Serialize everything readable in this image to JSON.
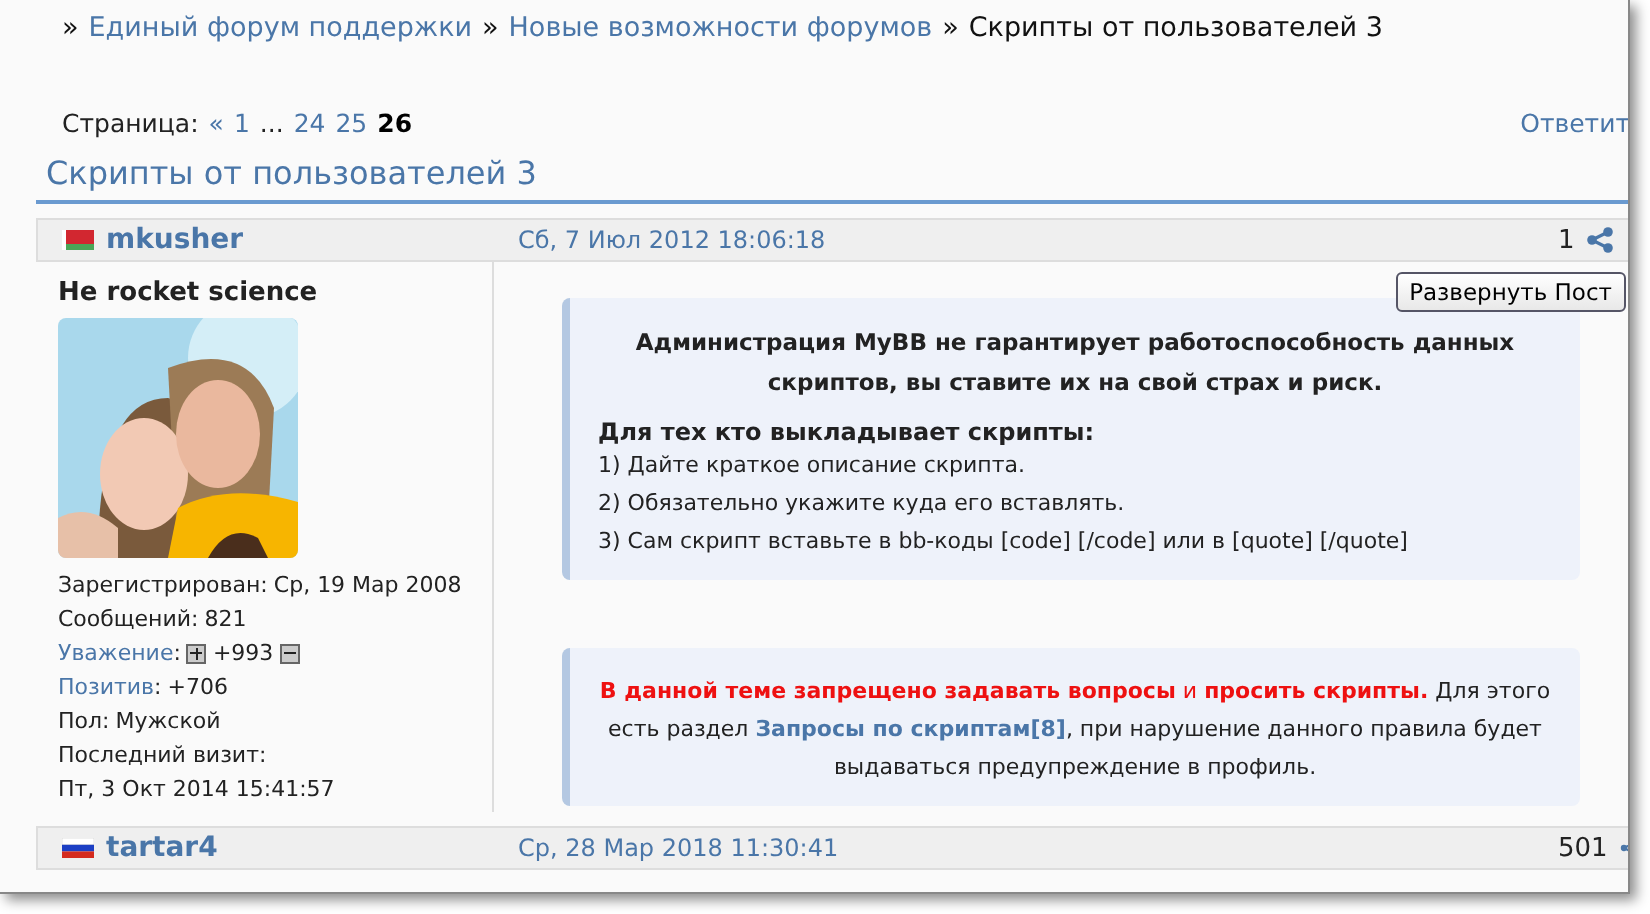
{
  "breadcrumb": [
    {
      "kind": "link",
      "text": "Единый форум поддержки"
    },
    {
      "kind": "link",
      "text": "Новые возможности форумов"
    },
    {
      "kind": "current",
      "text": "Скрипты от пользователей 3"
    }
  ],
  "breadcrumb_separator": "»",
  "pagination": {
    "label": "Страница:",
    "prev": "«",
    "pages": [
      {
        "text": "1",
        "selected": false
      },
      {
        "text": "...",
        "kind": "gap",
        "selected": false
      },
      {
        "text": "24",
        "selected": false
      },
      {
        "text": "25",
        "selected": false
      },
      {
        "text": "26",
        "selected": true
      }
    ]
  },
  "reply_link": "Ответит",
  "topic_title": "Скрипты от пользователей 3",
  "posts": [
    {
      "author": "mkusher",
      "flag": {
        "kind": "by"
      },
      "date": "Сб, 7 Июл 2012 18:06:18",
      "number": "1",
      "user_title": "Не rocket science",
      "avatar": {
        "kind": "picture"
      },
      "profile": [
        {
          "kind": "text",
          "label": "Зарегистрирован:",
          "value": "Ср, 19 Мар 2008"
        },
        {
          "kind": "text",
          "label": "Сообщений:",
          "value": "821"
        },
        {
          "kind": "vote",
          "label": "Уважение",
          "separator": ":",
          "value": "+993"
        },
        {
          "kind": "link",
          "label": "Позитив",
          "separator": ":",
          "value": "+706"
        },
        {
          "kind": "text",
          "label": "Пол:",
          "value": "Мужской"
        },
        {
          "kind": "text",
          "label": "Последний визит:"
        },
        {
          "kind": "plain",
          "value": "Пт, 3 Окт 2014 15:41:57"
        }
      ],
      "expand_button": "Развернуть Пост",
      "notices": [
        {
          "kind": "rules",
          "heading": "Администрация MyBB не гарантирует работоспособность данных скриптов, вы ставите их на свой страх и риск.",
          "subheading": "Для тех кто выкладывает скрипты:",
          "items": [
            "1) Дайте краткое описание скрипта.",
            "2) Обязательно укажите куда его вставлять.",
            "3) Сам скрипт вставьте в bb-коды [code] [/code] или в [quote] [/quote]"
          ]
        },
        {
          "kind": "warning",
          "warning": "**В данной теме запрещено задавать вопросы** и **просить скрипты.**",
          "text_before": "Для этого есть раздел",
          "link": "Запросы по скриптам[8]",
          "text_after": ", при нарушение данного правила будет выдаваться предупреждение в профиль."
        }
      ]
    },
    {
      "author": "tartar4",
      "flag": {
        "kind": "ru"
      },
      "date": "Ср, 28 Мар 2018 11:30:41",
      "number": "501"
    }
  ]
}
